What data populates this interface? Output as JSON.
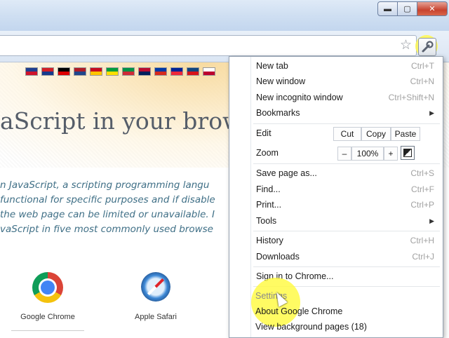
{
  "window": {
    "minimize_symbol": "▬",
    "maximize_symbol": "▢",
    "close_symbol": "✕"
  },
  "toolbar": {
    "star_icon": "star-icon",
    "wrench_icon": "wrench-icon",
    "star_symbol": "☆",
    "wrench_symbol": "🔧"
  },
  "page": {
    "flags": [
      "GB",
      "HR",
      "DE",
      "NL",
      "ES",
      "BR",
      "IT",
      "NO",
      "RU",
      "FR",
      "CZ",
      "JP"
    ],
    "flag_colors": [
      [
        "#1f3f8f",
        "#cf142b"
      ],
      [
        "#d21f26",
        "#173b8c"
      ],
      [
        "#000000",
        "#dd0000"
      ],
      [
        "#ae1c28",
        "#21468b"
      ],
      [
        "#c60b1e",
        "#ffc400"
      ],
      [
        "#009c3b",
        "#ffdf00"
      ],
      [
        "#009246",
        "#ce2b37"
      ],
      [
        "#ba0c2f",
        "#00205b"
      ],
      [
        "#0039a6",
        "#d52b1e"
      ],
      [
        "#002395",
        "#ed2939"
      ],
      [
        "#11457e",
        "#d7141a"
      ],
      [
        "#ffffff",
        "#bc002d"
      ]
    ],
    "heading": "aScript in your brows",
    "intro_lines": [
      "n JavaScript, a scripting programming langu",
      "functional for specific purposes and if disable",
      "the web page can be limited or unavailable. I",
      "vaScript in five most commonly used browse"
    ],
    "browsers": [
      {
        "label": "Google Chrome"
      },
      {
        "label": "Apple Safari"
      }
    ]
  },
  "menu": {
    "new_tab": {
      "label": "New tab",
      "shortcut": "Ctrl+T"
    },
    "new_window": {
      "label": "New window",
      "shortcut": "Ctrl+N"
    },
    "new_incognito": {
      "label": "New incognito window",
      "shortcut": "Ctrl+Shift+N"
    },
    "bookmarks": {
      "label": "Bookmarks",
      "arrow": "▶"
    },
    "edit": {
      "label": "Edit",
      "cut": "Cut",
      "copy": "Copy",
      "paste": "Paste"
    },
    "zoom": {
      "label": "Zoom",
      "minus": "–",
      "value": "100%",
      "plus": "+"
    },
    "save_page": {
      "label": "Save page as...",
      "shortcut": "Ctrl+S"
    },
    "find": {
      "label": "Find...",
      "shortcut": "Ctrl+F"
    },
    "print": {
      "label": "Print...",
      "shortcut": "Ctrl+P"
    },
    "tools": {
      "label": "Tools",
      "arrow": "▶"
    },
    "history": {
      "label": "History",
      "shortcut": "Ctrl+H"
    },
    "downloads": {
      "label": "Downloads",
      "shortcut": "Ctrl+J"
    },
    "sign_in": {
      "label": "Sign in to Chrome..."
    },
    "settings": {
      "label": "Settings"
    },
    "about": {
      "label": "About Google Chrome"
    },
    "background_pages": {
      "label": "View background pages (18)"
    }
  }
}
